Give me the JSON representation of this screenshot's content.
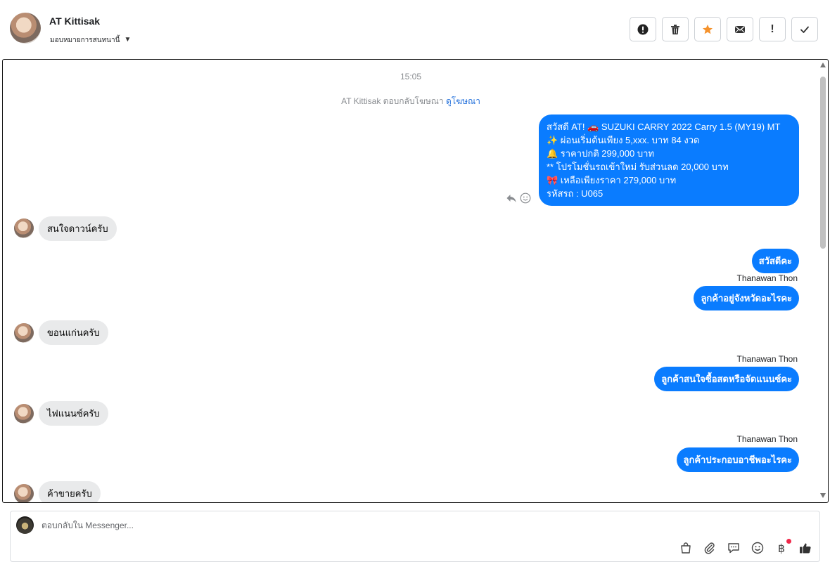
{
  "header": {
    "contact_name": "AT Kittisak",
    "assign_label": "มอบหมายการสนทนานี้",
    "toolbar": [
      {
        "name": "spam-report-button",
        "icon": "alert-circle-icon"
      },
      {
        "name": "delete-button",
        "icon": "trash-icon"
      },
      {
        "name": "star-button",
        "icon": "star-icon"
      },
      {
        "name": "mark-unread-button",
        "icon": "envelope-icon"
      },
      {
        "name": "mark-important-button",
        "icon": "exclamation-icon",
        "text": "!"
      },
      {
        "name": "mark-done-button",
        "icon": "checkmark-icon"
      }
    ],
    "star_color": "#f5922c"
  },
  "conversation": {
    "timestamp": "15:05",
    "ad_reply": {
      "prefix": "AT Kittisak ตอบกลับโฆษณา",
      "link": "ดูโฆษณา"
    },
    "ad_message": {
      "lines": [
        "สวัสดี AT! 🚗  SUZUKI CARRY 2022 Carry 1.5 (MY19) MT",
        "✨  ผ่อนเริ่มต้นเพียง 5,xxx. บาท 84 งวด",
        "🔔 ราคาปกติ 299,000 บาท",
        "** โปรโมชั่นรถเข้าใหม่ รับส่วนลด 20,000 บาท",
        "🎀  เหลือเพียงราคา 279,000 บาท",
        " รหัสรถ : U065"
      ]
    },
    "messages": [
      {
        "from": "customer",
        "text": "สนใจดาวน์ครับ"
      },
      {
        "from": "page",
        "text": "สวัสดีคะ"
      },
      {
        "from": "page",
        "sender": "Thanawan Thon",
        "text": "ลูกค้าอยู่จังหวัดอะไรคะ"
      },
      {
        "from": "customer",
        "text": "ขอนแก่นครับ"
      },
      {
        "from": "page",
        "sender": "Thanawan Thon",
        "text": "ลูกค้าสนใจซื้อสดหรือจัดแนนซ์คะ"
      },
      {
        "from": "customer",
        "text": "ไฟแนนซ์ครับ"
      },
      {
        "from": "page",
        "sender": "Thanawan Thon",
        "text": "ลูกค้าประกอบอาชีพอะไรคะ"
      },
      {
        "from": "customer",
        "text": "ค้าขายครับ"
      }
    ],
    "bubble_color": "#0a7cff"
  },
  "composer": {
    "placeholder": "ตอบกลับใน Messenger...",
    "tools": [
      "shopping-bag-icon",
      "paperclip-icon",
      "saved-reply-icon",
      "emoji-icon",
      "baht-icon",
      "thumbs-up-icon"
    ],
    "baht_symbol": "฿"
  }
}
